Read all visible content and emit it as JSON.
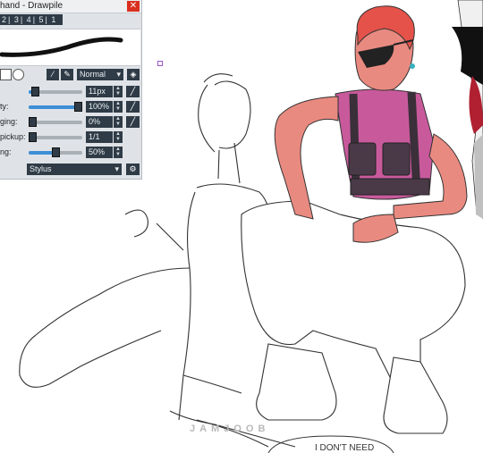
{
  "window": {
    "title": "hand - Drawpile",
    "close_label": "✕"
  },
  "brush_slots": {
    "items": [
      "2",
      "3",
      "4",
      "5",
      "1"
    ],
    "eraser_icon": "eraser-icon"
  },
  "toolbar": {
    "blend_mode": "Normal",
    "shape_square": "square-brush-shape",
    "shape_round": "round-brush-shape",
    "colorpicker_icon": "eyedropper-icon",
    "eraser_icon": "eraser-icon",
    "stamp_icon": "stamp-icon"
  },
  "settings": [
    {
      "label": "",
      "value": "11px",
      "level": 0.05
    },
    {
      "label": "ty:",
      "value": "100%",
      "level": 1.0
    },
    {
      "label": "ging:",
      "value": "0%",
      "level": 0.0
    },
    {
      "label": "pickup:",
      "value": "1/1",
      "level": 0.0
    },
    {
      "label": "ng:",
      "value": "50%",
      "level": 0.5
    }
  ],
  "device": {
    "selected": "Stylus",
    "settings_icon": "tablet-settings-icon"
  },
  "canvas": {
    "watermark": "JAMJOOB",
    "speech_fragment": "I DON'T NEED"
  },
  "colors": {
    "panel_bg": "#dfe3e7",
    "dark_widget": "#2f3b46",
    "accent_blue": "#3d8fd6",
    "close_red": "#d9301f",
    "skin": "#e98a80",
    "hair": "#e4524a",
    "shirt": "#c85a9c",
    "vest": "#4a3a48",
    "pupil_purple": "#9a55c8"
  }
}
